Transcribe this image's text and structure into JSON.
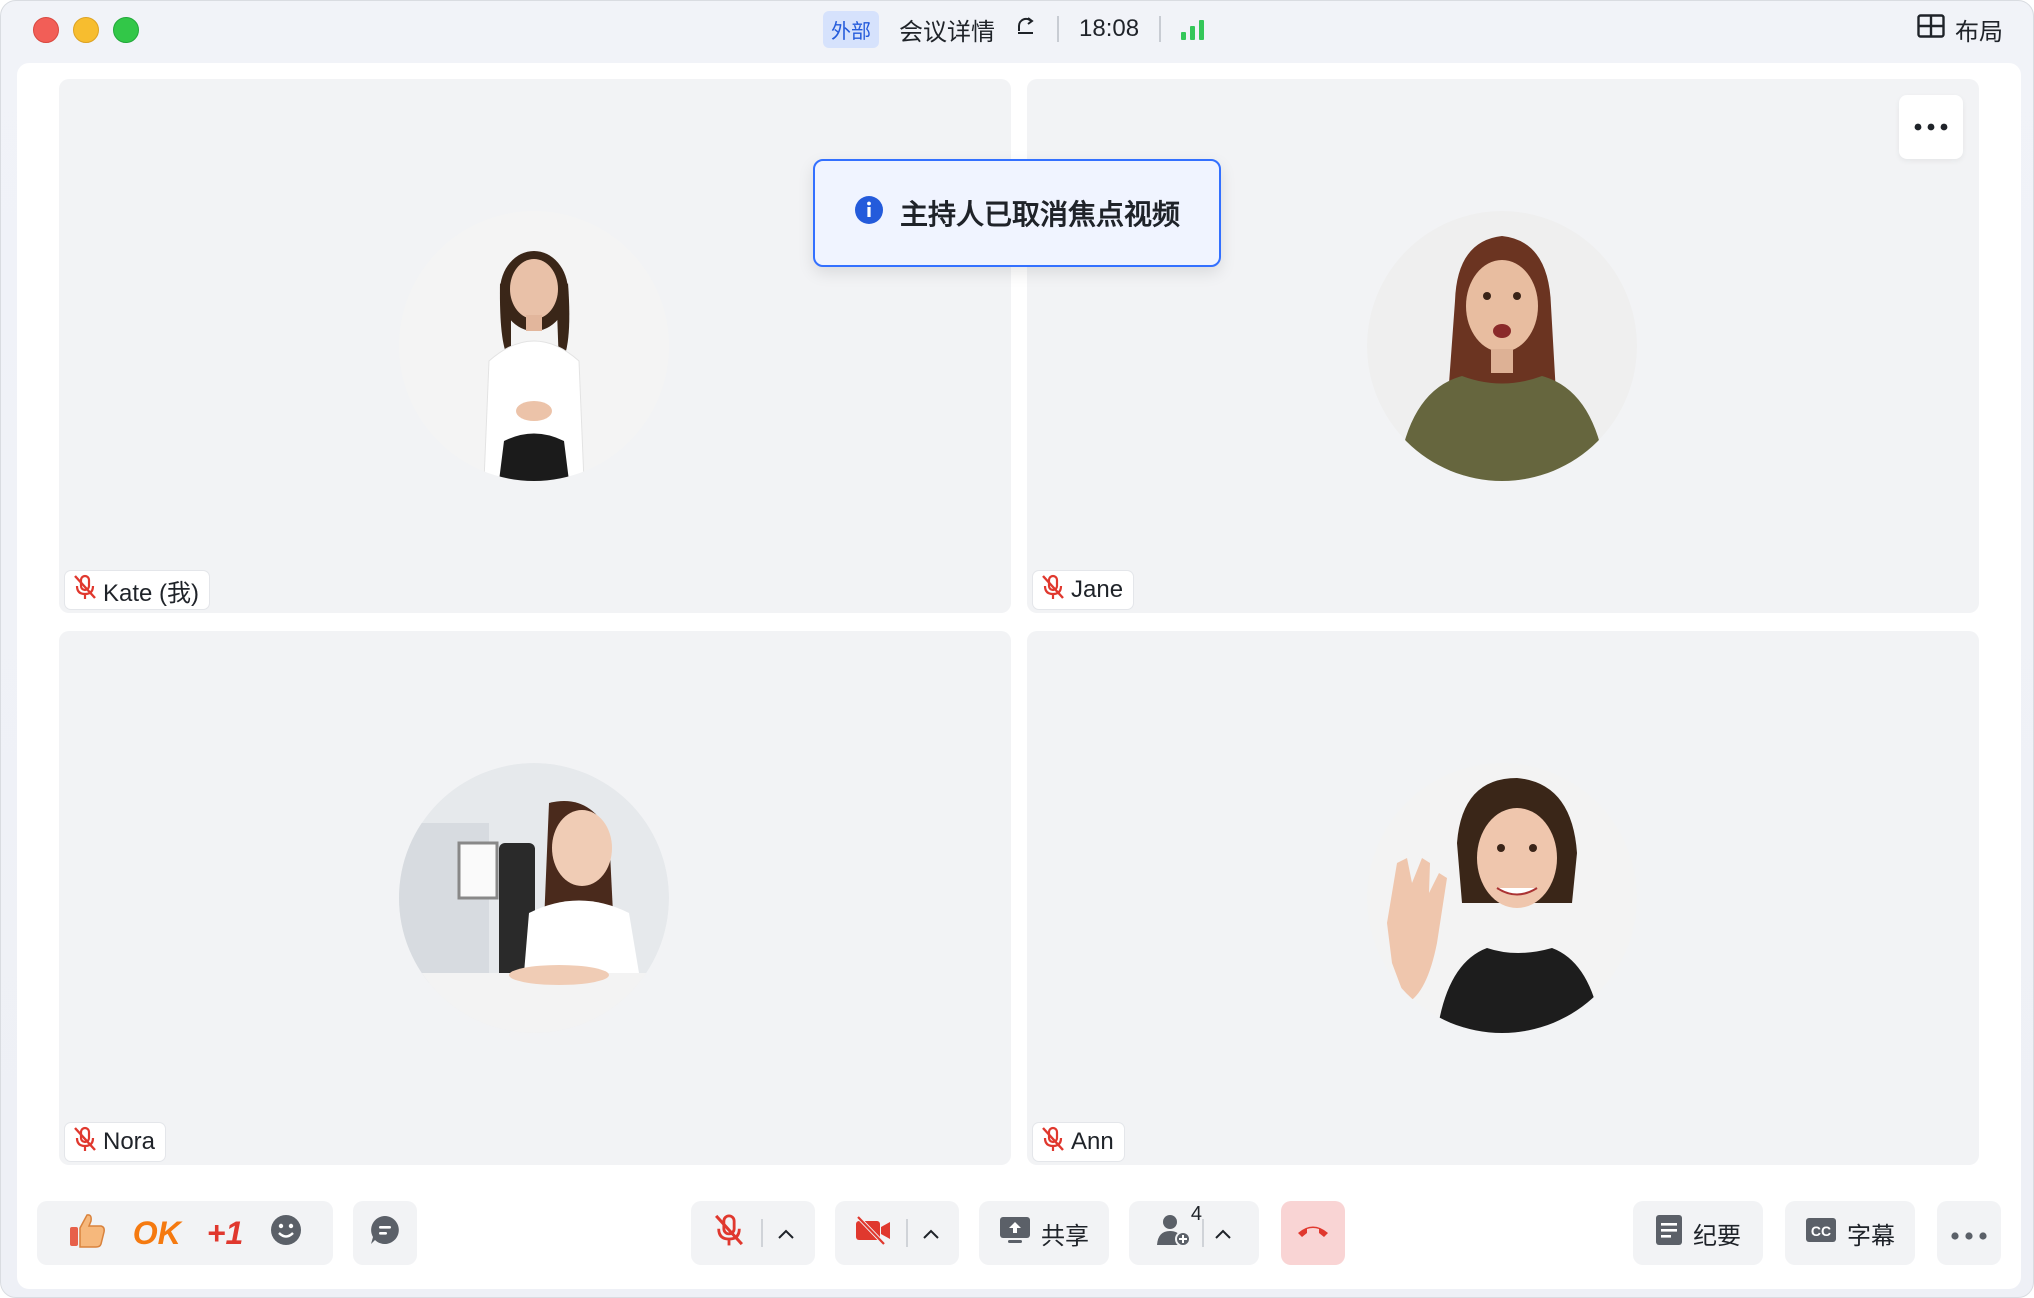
{
  "titlebar": {
    "badge": "外部",
    "meeting_title": "会议详情",
    "time": "18:08",
    "layout_label": "布局"
  },
  "toast": {
    "message": "主持人已取消焦点视频"
  },
  "participants": [
    {
      "name": "Kate (我)",
      "muted": true
    },
    {
      "name": "Jane",
      "muted": true
    },
    {
      "name": "Nora",
      "muted": true
    },
    {
      "name": "Ann",
      "muted": true
    }
  ],
  "toolbar": {
    "reaction_ok": "OK",
    "reaction_plus_one": "+1",
    "share_label": "共享",
    "participant_count": "4",
    "minutes_label": "纪要",
    "captions_label": "字幕"
  },
  "colors": {
    "accent": "#3370ff",
    "muted_red": "#e0382e",
    "leave_bg": "#f9d4d4",
    "signal_green": "#34c759"
  },
  "icons": [
    "refresh-icon",
    "signal-icon",
    "layout-grid-icon",
    "info-icon",
    "more-icon",
    "mic-off-icon",
    "thumbs-up-icon",
    "emoji-icon",
    "chat-icon",
    "camera-off-icon",
    "chevron-up-icon",
    "share-screen-icon",
    "add-person-icon",
    "hang-up-icon",
    "document-icon",
    "cc-icon"
  ]
}
